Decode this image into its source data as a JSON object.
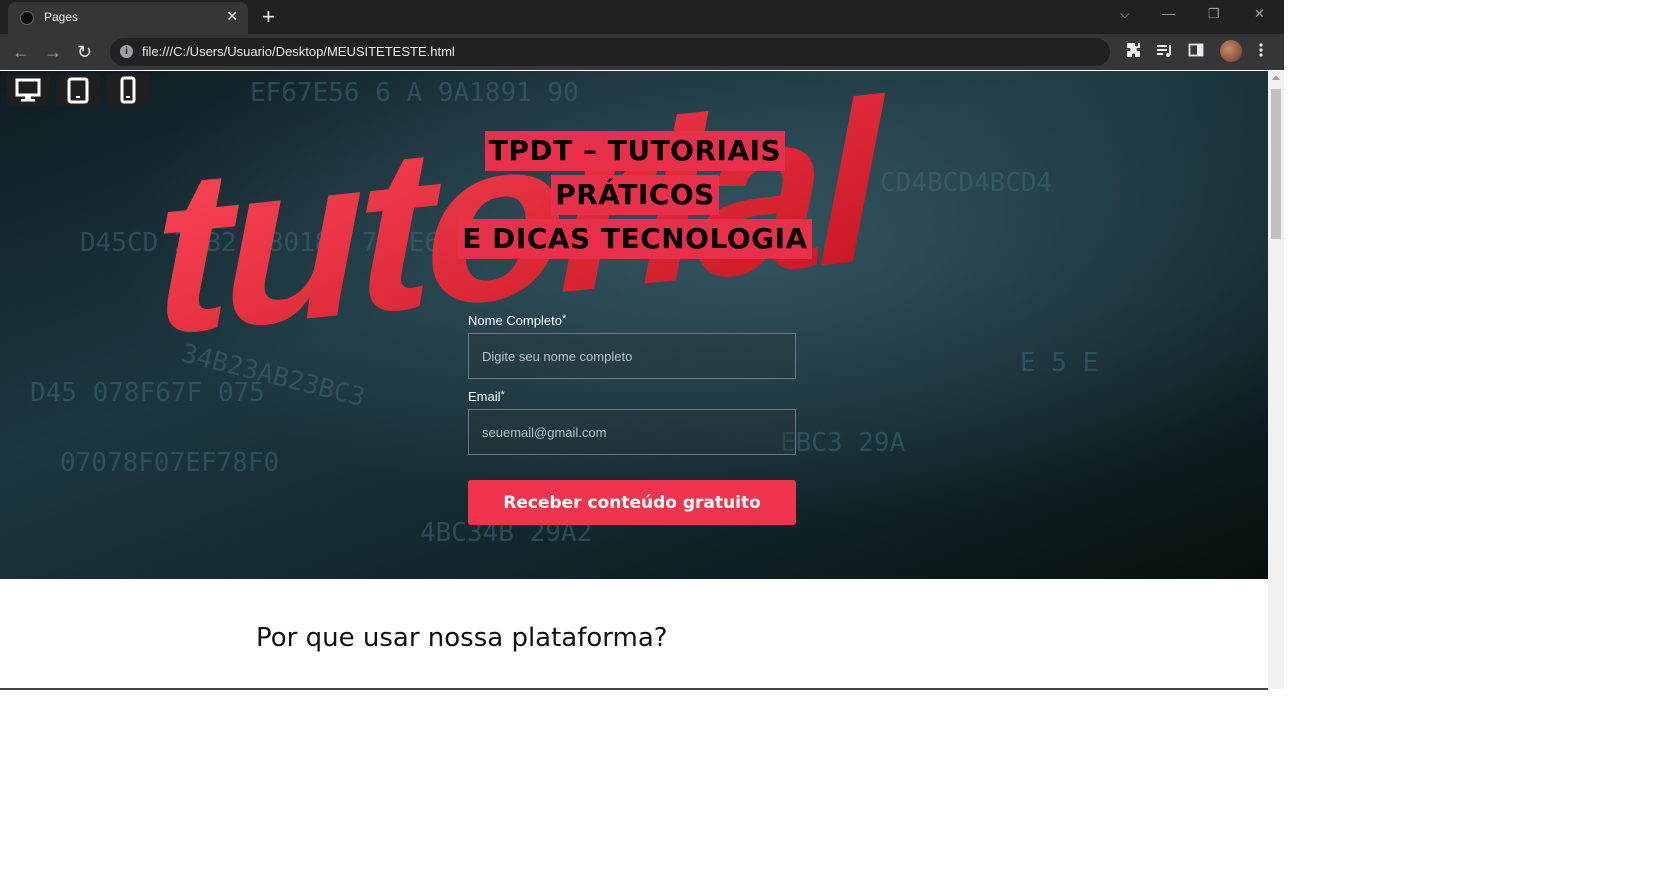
{
  "browser": {
    "tab_title": "Pages",
    "tab_close": "✕",
    "new_tab": "+",
    "url": "file:///C:/Users/Usuario/Desktop/MEUSITETESTE.html",
    "controls": {
      "dropdown": "⌵",
      "minimize": "—",
      "restore": "❐",
      "close": "✕"
    },
    "nav": {
      "back": "←",
      "forward": "→",
      "reload": "↻"
    }
  },
  "device_switcher": {
    "items": [
      {
        "name": "desktop-view-icon"
      },
      {
        "name": "tablet-view-icon"
      },
      {
        "name": "mobile-view-icon"
      }
    ]
  },
  "hero": {
    "title_lines": [
      "TPDT – TUTORIAIS",
      "PRÁTICOS",
      "E DICAS TECNOLOGIA"
    ],
    "background_word": "tutorial",
    "accent_color": "#e8304a"
  },
  "form": {
    "name_label": "Nome Completo",
    "name_required": "*",
    "name_placeholder": "Digite seu nome completo",
    "email_label": "Email",
    "email_required": "*",
    "email_placeholder": "seuemail@gmail.com",
    "submit_label": "Receber conteúdo gratuito",
    "button_color": "#f0344d"
  },
  "section": {
    "title": "Por que usar nossa plataforma?"
  }
}
